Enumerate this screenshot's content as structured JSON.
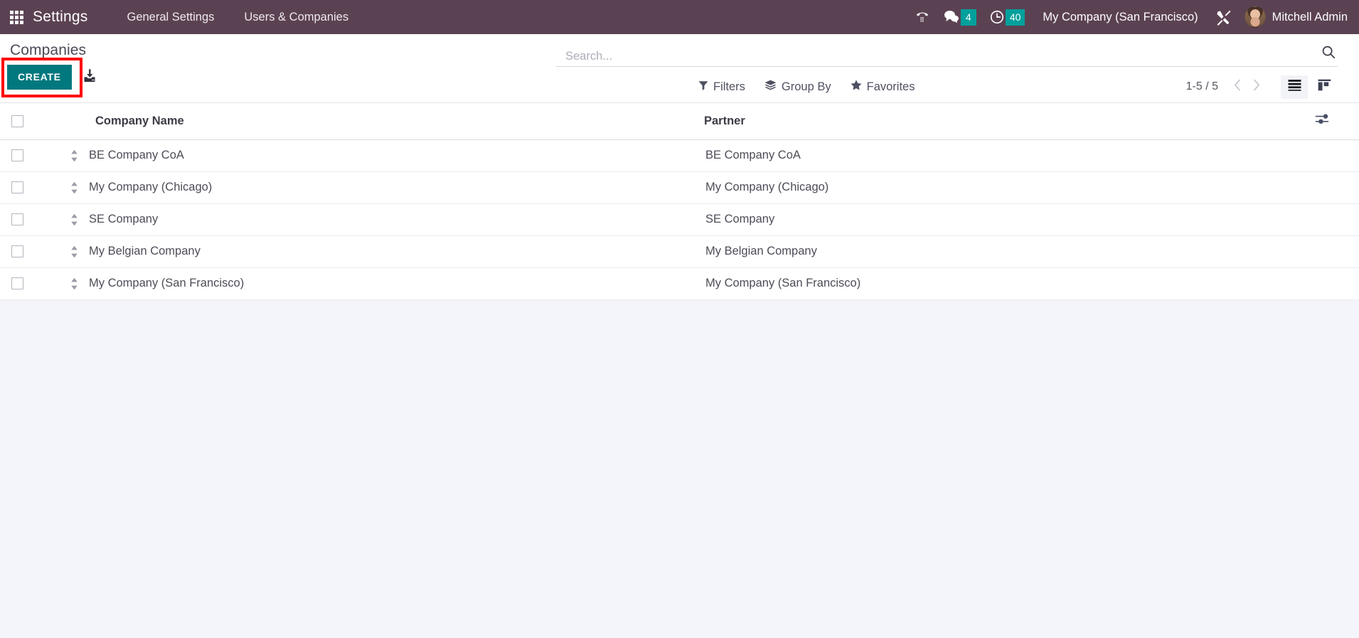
{
  "navbar": {
    "apps_icon": "grid-apps-icon",
    "brand": "Settings",
    "menus": [
      {
        "label": "General Settings"
      },
      {
        "label": "Users & Companies"
      }
    ],
    "systray": [
      {
        "icon": "phone-dialpad-icon",
        "badge": null
      },
      {
        "icon": "messages-bubble-icon",
        "badge": "4"
      },
      {
        "icon": "activities-clock-icon",
        "badge": "40"
      }
    ],
    "company_switcher": "My Company (San Francisco)",
    "debug_icon": "tools-wrench-screwdriver-icon",
    "user_name": "Mitchell Admin",
    "avatar": "user-avatar",
    "badge_color": "#00a09d",
    "background_color": "#5b4253"
  },
  "control_panel": {
    "breadcrumb": "Companies",
    "create_label": "CREATE",
    "create_color": "#00787e",
    "import_icon": "import-download-icon",
    "highlight_color": "#ff0000",
    "search": {
      "placeholder": "Search...",
      "value": "",
      "icon": "search-magnifier-icon"
    },
    "tools": [
      {
        "label": "Filters",
        "icon": "filter-funnel-icon"
      },
      {
        "label": "Group By",
        "icon": "layers-stack-icon"
      },
      {
        "label": "Favorites",
        "icon": "star-icon"
      }
    ],
    "pager": "1-5 / 5",
    "prev_icon": "chevron-left-icon",
    "next_icon": "chevron-right-icon",
    "views": [
      {
        "name": "list",
        "icon": "list-view-icon",
        "active": true
      },
      {
        "name": "kanban",
        "icon": "kanban-view-icon",
        "active": false
      }
    ]
  },
  "list": {
    "columns": [
      {
        "key": "company_name",
        "label": "Company Name"
      },
      {
        "key": "partner",
        "label": "Partner"
      }
    ],
    "optional_columns_icon": "column-options-sliders-icon",
    "select_all_checkbox": false,
    "rows": [
      {
        "company_name": "BE Company CoA",
        "partner": "BE Company CoA",
        "selected": false
      },
      {
        "company_name": "My Company (Chicago)",
        "partner": "My Company (Chicago)",
        "selected": false
      },
      {
        "company_name": "SE Company",
        "partner": "SE Company",
        "selected": false
      },
      {
        "company_name": "My Belgian Company",
        "partner": "My Belgian Company",
        "selected": false
      },
      {
        "company_name": "My Company (San Francisco)",
        "partner": "My Company (San Francisco)",
        "selected": false
      }
    ]
  }
}
